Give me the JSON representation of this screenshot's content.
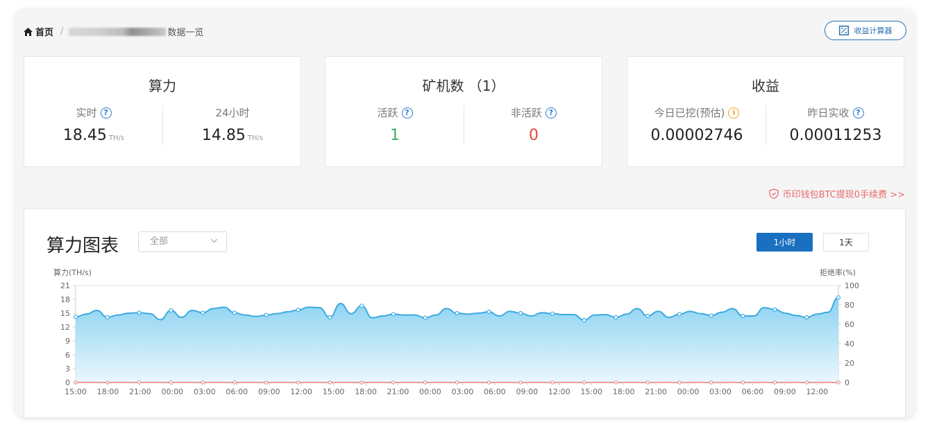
{
  "breadcrumb": {
    "home": "首页",
    "separator": "/",
    "page": "数据一览"
  },
  "calculator_button": {
    "label": "收益计算器"
  },
  "cards": {
    "hashrate": {
      "title": "算力",
      "realtime": {
        "label": "实时",
        "value": "18.45",
        "unit": "TH/s"
      },
      "day": {
        "label": "24小时",
        "value": "14.85",
        "unit": "TH/s"
      }
    },
    "miners": {
      "title": "矿机数 （1）",
      "active": {
        "label": "活跃",
        "value": "1"
      },
      "inactive": {
        "label": "非活跃",
        "value": "0"
      }
    },
    "earnings": {
      "title": "收益",
      "today": {
        "label": "今日已挖(预估)",
        "value": "0.00002746"
      },
      "yesterday": {
        "label": "昨日实收",
        "value": "0.00011253"
      }
    }
  },
  "promo": {
    "text": "币印钱包BTC提现0手续费 >>"
  },
  "chart_panel": {
    "title": "算力图表",
    "select_value": "全部",
    "tabs": [
      {
        "label": "1小时",
        "active": true
      },
      {
        "label": "1天",
        "active": false
      }
    ]
  },
  "chart_data": {
    "type": "area",
    "ylabel": "算力(TH/s)",
    "y2label": "拒绝率(%)",
    "ylim": [
      0,
      21
    ],
    "yticks": [
      0,
      3,
      6,
      9,
      12,
      15,
      18,
      21
    ],
    "y2lim": [
      0,
      100
    ],
    "y2ticks": [
      0,
      20,
      40,
      60,
      80,
      100
    ],
    "xticks": [
      "15:00",
      "18:00",
      "21:00",
      "00:00",
      "03:00",
      "06:00",
      "09:00",
      "12:00",
      "15:00",
      "18:00",
      "21:00",
      "00:00",
      "03:00",
      "06:00",
      "09:00",
      "12:00",
      "15:00",
      "18:00",
      "21:00",
      "00:00",
      "03:00",
      "06:00",
      "09:00",
      "12:00"
    ],
    "grid": true,
    "series": [
      {
        "name": "算力",
        "color": "#3aa9e0",
        "values": [
          14.2,
          14.8,
          15.6,
          14.1,
          14.6,
          15.0,
          15.1,
          14.9,
          13.6,
          15.6,
          14.1,
          15.6,
          15.1,
          16.0,
          16.3,
          15.1,
          14.6,
          14.3,
          14.6,
          14.9,
          15.3,
          15.7,
          16.3,
          16.2,
          14.1,
          17.1,
          14.9,
          16.6,
          14.0,
          14.4,
          14.8,
          14.6,
          14.6,
          14.0,
          14.6,
          16.0,
          15.0,
          14.8,
          15.0,
          15.3,
          14.4,
          15.4,
          15.0,
          14.4,
          15.1,
          14.9,
          14.7,
          14.7,
          13.5,
          14.6,
          14.7,
          14.1,
          14.8,
          16.0,
          14.4,
          15.4,
          14.1,
          14.8,
          15.4,
          14.9,
          14.5,
          15.2,
          16.0,
          14.4,
          14.4,
          16.2,
          15.8,
          15.0,
          14.5,
          14.1,
          14.8,
          15.2,
          18.4
        ]
      },
      {
        "name": "拒绝率",
        "color": "#f07b7b",
        "values": [
          0,
          0,
          0,
          0,
          0,
          0,
          0,
          0,
          0,
          0,
          0,
          0,
          0,
          0,
          0,
          0,
          0,
          0,
          0,
          0,
          0,
          0,
          0,
          0,
          0
        ]
      }
    ]
  }
}
